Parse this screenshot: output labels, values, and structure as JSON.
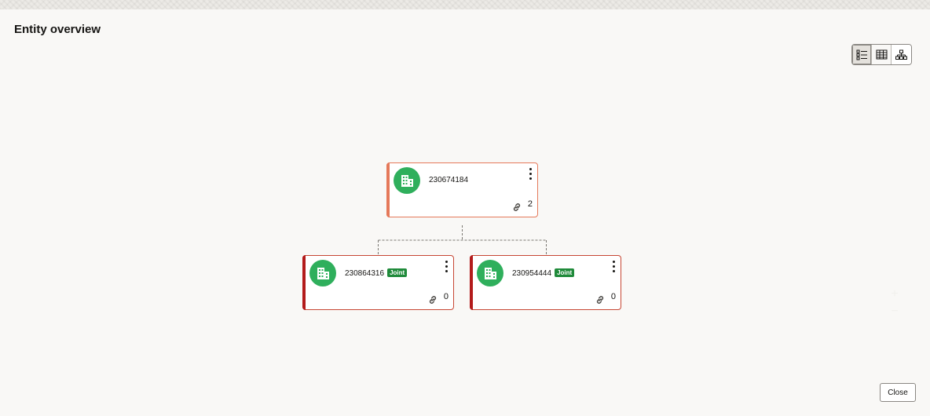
{
  "page": {
    "title": "Entity overview"
  },
  "view_switcher": {
    "options": [
      {
        "icon": "list-view-icon",
        "state": "selected"
      },
      {
        "icon": "table-view-icon",
        "state": "normal"
      },
      {
        "icon": "hierarchy-view-icon",
        "state": "active"
      }
    ]
  },
  "tree": {
    "root": {
      "id": "230674184",
      "link_count": "2"
    },
    "children": [
      {
        "id": "230864316",
        "badge": "Joint",
        "link_count": "0"
      },
      {
        "id": "230954444",
        "badge": "Joint",
        "link_count": "0"
      }
    ]
  },
  "zoom": {
    "in_label": "+",
    "out_label": "−"
  },
  "footer": {
    "close_label": "Close"
  },
  "colors": {
    "avatar": "#2faf5c",
    "root_border": "#e5795a",
    "child_border": "#c74634",
    "child_bar": "#b31b1b",
    "badge": "#1f8a3a"
  }
}
